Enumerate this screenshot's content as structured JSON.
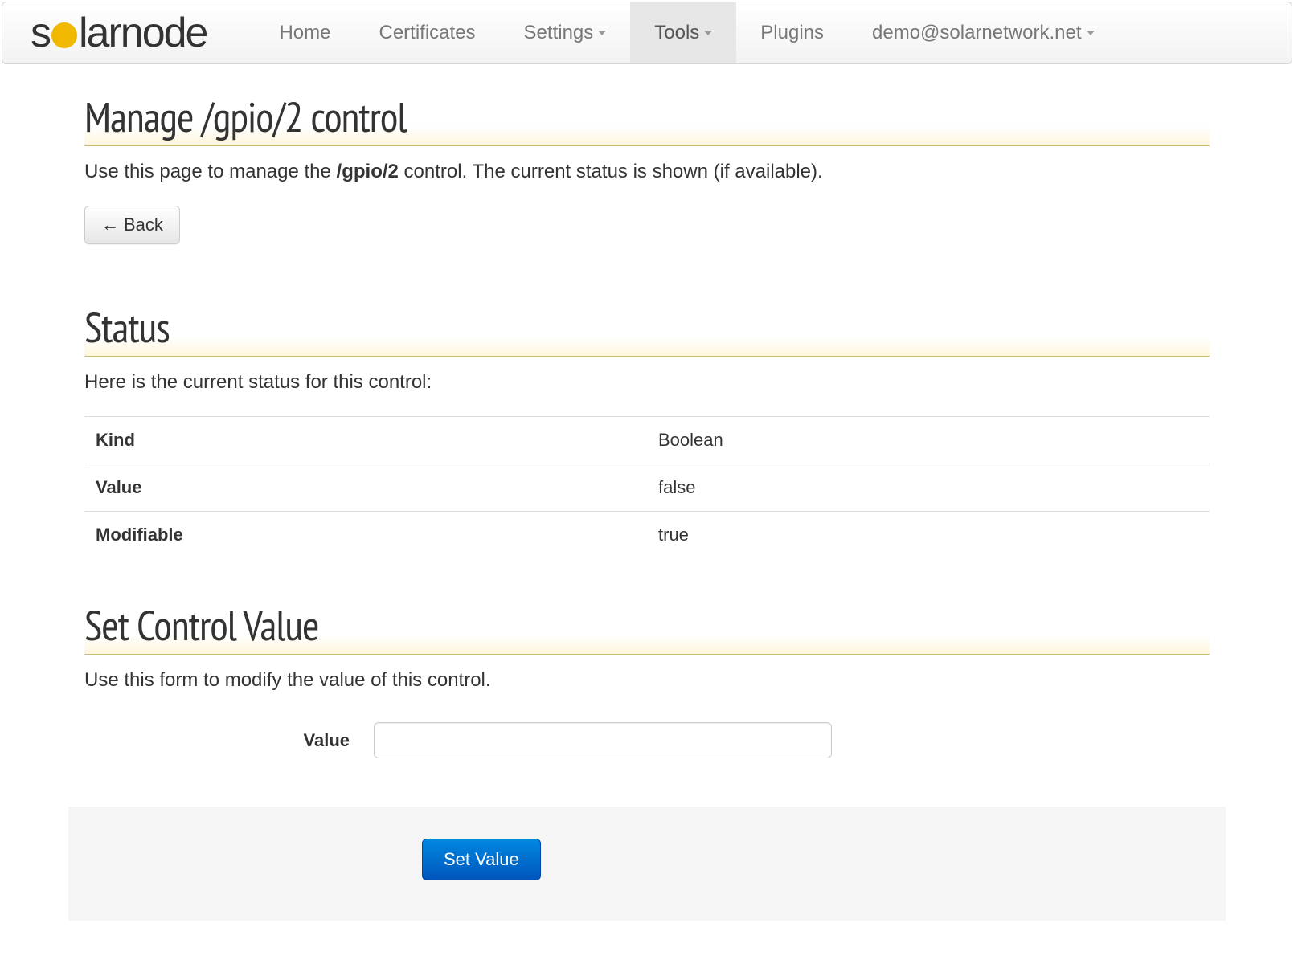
{
  "navbar": {
    "brand_prefix": "s",
    "brand_suffix": "larnode",
    "links": {
      "home": "Home",
      "certificates": "Certificates",
      "settings": "Settings",
      "tools": "Tools",
      "plugins": "Plugins",
      "user": "demo@solarnetwork.net"
    }
  },
  "page": {
    "title": "Manage /gpio/2 control",
    "description_prefix": "Use this page to manage the ",
    "description_bold": "/gpio/2",
    "description_suffix": " control. The current status is shown (if available).",
    "back_label": "Back"
  },
  "status": {
    "heading": "Status",
    "description": "Here is the current status for this control:",
    "rows": [
      {
        "key": "Kind",
        "value": "Boolean"
      },
      {
        "key": "Value",
        "value": "false"
      },
      {
        "key": "Modifiable",
        "value": "true"
      }
    ]
  },
  "set_value": {
    "heading": "Set Control Value",
    "description": "Use this form to modify the value of this control.",
    "value_label": "Value",
    "submit_label": "Set Value"
  }
}
